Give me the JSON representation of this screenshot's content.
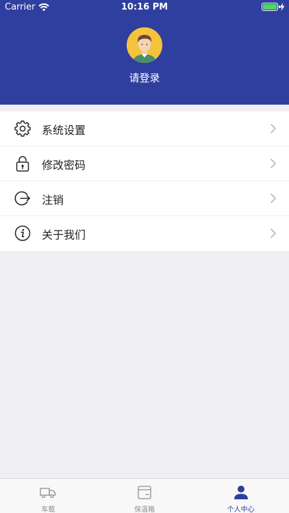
{
  "status_bar": {
    "carrier": "Carrier",
    "time": "10:16 PM"
  },
  "profile": {
    "login_text": "请登录"
  },
  "menu": {
    "items": [
      {
        "label": "系统设置",
        "icon": "gear-icon"
      },
      {
        "label": "修改密码",
        "icon": "lock-icon"
      },
      {
        "label": "注销",
        "icon": "logout-icon"
      },
      {
        "label": "关于我们",
        "icon": "info-icon"
      }
    ]
  },
  "tabbar": {
    "tabs": [
      {
        "label": "车载",
        "icon": "truck-icon",
        "active": false
      },
      {
        "label": "保温箱",
        "icon": "box-icon",
        "active": false
      },
      {
        "label": "个人中心",
        "icon": "person-icon",
        "active": true
      }
    ]
  },
  "colors": {
    "header_bg": "#2f3f9f",
    "accent": "#2f3f9f",
    "battery": "#4cd964",
    "avatar_bg": "#f5c23e"
  }
}
